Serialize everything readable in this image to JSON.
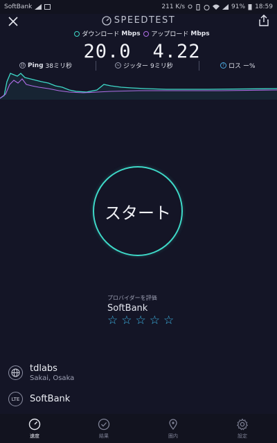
{
  "status_bar": {
    "carrier": "SoftBank",
    "speed": "211 K/s",
    "battery": "91%",
    "time": "18:59"
  },
  "header": {
    "brand": "SPEEDTEST"
  },
  "download": {
    "label": "ダウンロード",
    "unit": "Mbps",
    "value": "20.0",
    "color": "#3ed9c8"
  },
  "upload": {
    "label": "アップロード",
    "unit": "Mbps",
    "value": "4.22",
    "color": "#b06ee8"
  },
  "stats": {
    "ping_label": "Ping",
    "ping_value": "38ミリ秒",
    "jitter_label": "ジッター",
    "jitter_value": "9ミリ秒",
    "loss_label": "ロス",
    "loss_value": "ー%"
  },
  "start_button": {
    "label": "スタート"
  },
  "provider": {
    "rate_label": "プロバイダーを評価",
    "name": "SoftBank",
    "stars": [
      "☆",
      "☆",
      "☆",
      "☆",
      "☆"
    ]
  },
  "server": {
    "name": "tdlabs",
    "location": "Sakai, Osaka",
    "icon": "globe-icon"
  },
  "network": {
    "badge": "LTE",
    "name": "SoftBank"
  },
  "nav": {
    "items": [
      {
        "label": "速度",
        "icon": "speedometer-icon"
      },
      {
        "label": "結果",
        "icon": "check-circle-icon"
      },
      {
        "label": "圏内",
        "icon": "location-pin-icon"
      },
      {
        "label": "設定",
        "icon": "gear-icon"
      }
    ]
  }
}
